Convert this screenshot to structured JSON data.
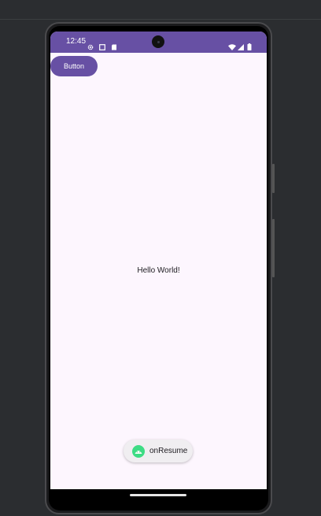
{
  "status_bar": {
    "time": "12:45",
    "icons": [
      "settings-icon",
      "notification-square-icon",
      "sd-card-icon",
      "wifi-icon",
      "cellular-signal-icon",
      "battery-icon"
    ],
    "color": "#6750a4"
  },
  "app": {
    "button_label": "Button",
    "hello_text": "Hello World!",
    "background": "#fdf6fe",
    "accent": "#6750a4"
  },
  "toast": {
    "icon": "android-icon",
    "text": "onResume"
  },
  "navigation": {
    "handle": "gesture-handle"
  }
}
